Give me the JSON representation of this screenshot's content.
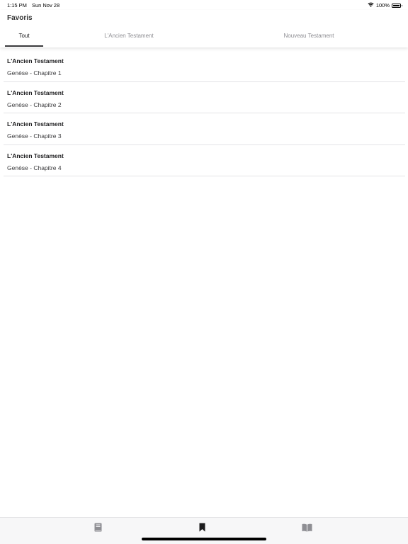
{
  "status_bar": {
    "time": "1:15 PM",
    "date": "Sun Nov 28",
    "battery": "100%",
    "wifi_icon": "wifi-icon",
    "battery_icon": "battery-full-icon"
  },
  "header": {
    "title": "Favoris"
  },
  "tabs": [
    {
      "label": "Tout",
      "active": true
    },
    {
      "label": "L'Ancien Testament",
      "active": false
    },
    {
      "label": "Nouveau Testament",
      "active": false
    }
  ],
  "favorites": [
    {
      "title": "L'Ancien Testament",
      "subtitle": "Genèse - Chapitre 1"
    },
    {
      "title": "L'Ancien Testament",
      "subtitle": "Genèse - Chapitre 2"
    },
    {
      "title": "L'Ancien Testament",
      "subtitle": "Genèse - Chapitre 3"
    },
    {
      "title": "L'Ancien Testament",
      "subtitle": "Genèse - Chapitre 4"
    }
  ],
  "tab_bar": {
    "items": [
      {
        "icon": "book-icon",
        "active": false
      },
      {
        "icon": "bookmark-icon",
        "active": true
      },
      {
        "icon": "open-book-icon",
        "active": false
      }
    ]
  },
  "colors": {
    "active_tab_text": "#1c1c1e",
    "inactive_tab_text": "#8e8e93",
    "tab_indicator": "#3a3a3c",
    "divider": "#e3e3e6",
    "tabbar_active_icon": "#1c1c1e",
    "tabbar_inactive_icon": "#8e8e93"
  }
}
